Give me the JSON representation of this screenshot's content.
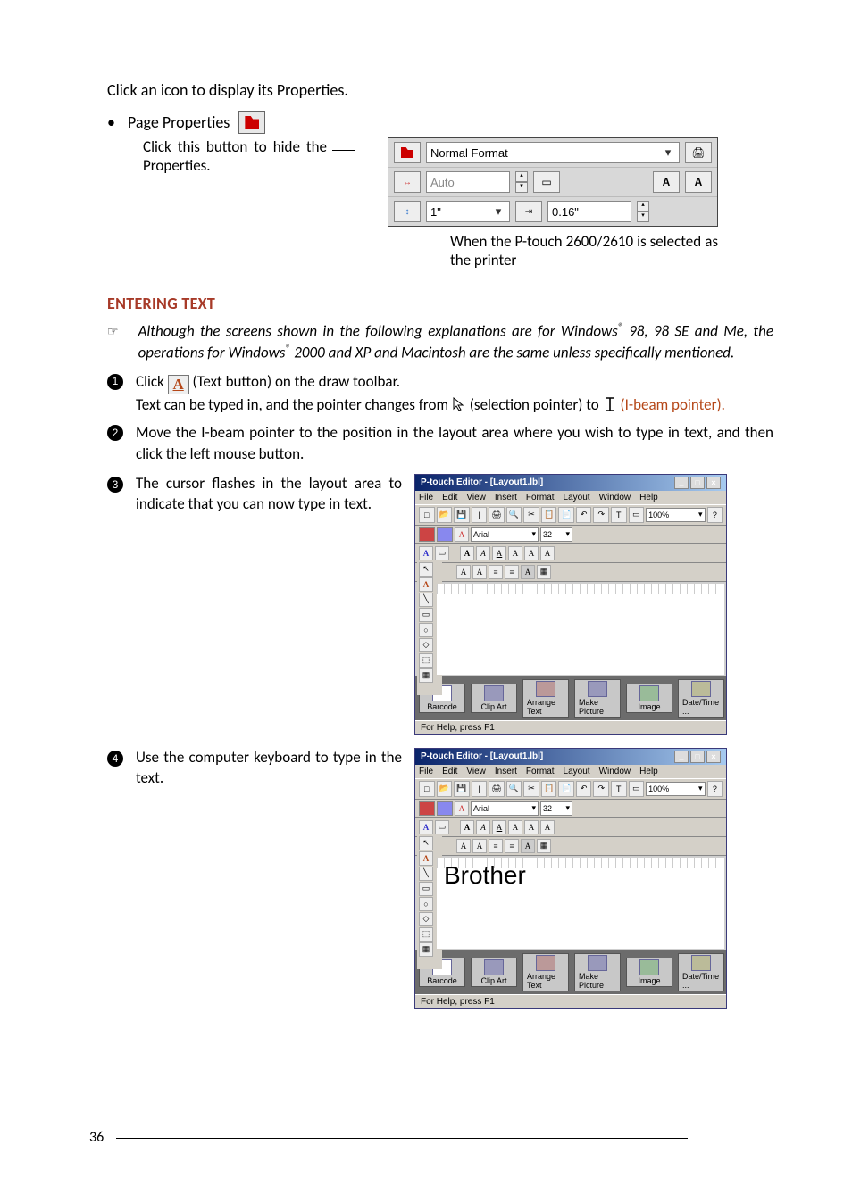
{
  "intro": "Click an icon to display its Properties.",
  "bullet_label": "Page Properties",
  "hide_caption": "Click this button to hide the Properties.",
  "panel": {
    "format_value": "Normal Format",
    "length_value": "Auto",
    "width_value": "1\"",
    "margin_value": "0.16\""
  },
  "panel_note": "When the P-touch 2600/2610 is selected as the printer",
  "section_heading": "ENTERING TEXT",
  "note": {
    "symbol": "☞",
    "text_before": "Although the screens shown in the following explanations are for Windows",
    "reg1": "®",
    "text_mid": " 98, 98 SE and Me, the operations for Windows",
    "reg2": "®",
    "text_after": " 2000 and XP and Macintosh are the same unless specifically mentioned."
  },
  "step1": {
    "line1a": "Click ",
    "line1b": " (Text button) on the draw toolbar.",
    "line2a": "Text can be typed in, and the pointer changes from ",
    "line2b": " (selection pointer) to ",
    "line2c": " (I-beam pointer)."
  },
  "step2": "Move the I-beam pointer to the position in the layout area where you wish to type in text, and then click the left mouse button.",
  "step3": "The cursor flashes in the layout area to indicate that you can now type in text.",
  "step4": "Use the computer keyboard to type in the text.",
  "screenshot": {
    "title": "P-touch Editor - [Layout1.lbl]",
    "menus": [
      "File",
      "Edit",
      "View",
      "Insert",
      "Format",
      "Layout",
      "Window",
      "Help"
    ],
    "zoom": "100%",
    "font": "Arial",
    "size": "32",
    "canvas_text_b": "Brother",
    "bottom_buttons": [
      "Barcode",
      "Clip Art",
      "Arrange Text",
      "Make Picture",
      "Image",
      "Date/Time ..."
    ],
    "status": "For Help, press F1"
  },
  "page_number": "36"
}
